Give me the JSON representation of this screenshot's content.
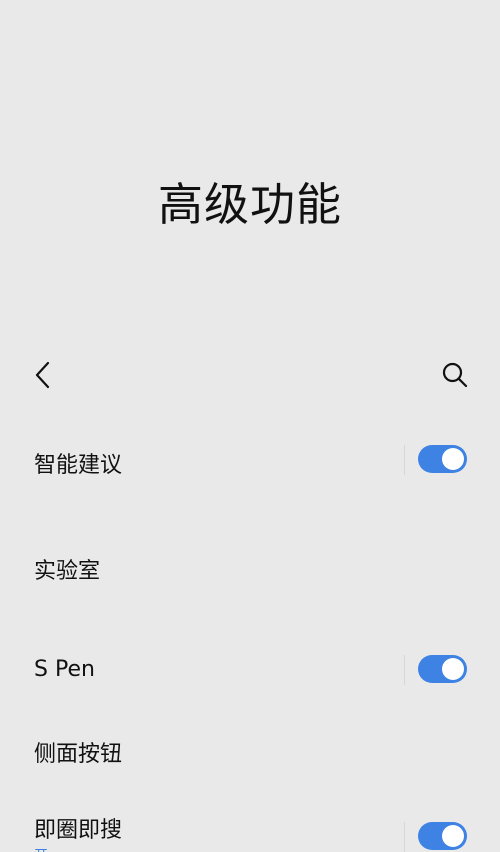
{
  "header": {
    "title": "高级功能",
    "back_icon": "chevron-left-icon",
    "search_icon": "search-icon"
  },
  "settings": [
    {
      "label": "智能建议",
      "toggle": true,
      "toggle_on": true
    },
    {
      "label": "实验室",
      "toggle": false
    },
    {
      "label": "S Pen",
      "toggle": true,
      "toggle_on": true
    },
    {
      "label": "侧面按钮",
      "toggle": false
    },
    {
      "label": "即圈即搜",
      "sublabel": "开",
      "toggle": true,
      "toggle_on": true
    }
  ],
  "colors": {
    "background": "#e9e9ea",
    "toggle_on": "#3e82e4",
    "accent_text": "#3d7fe6"
  }
}
